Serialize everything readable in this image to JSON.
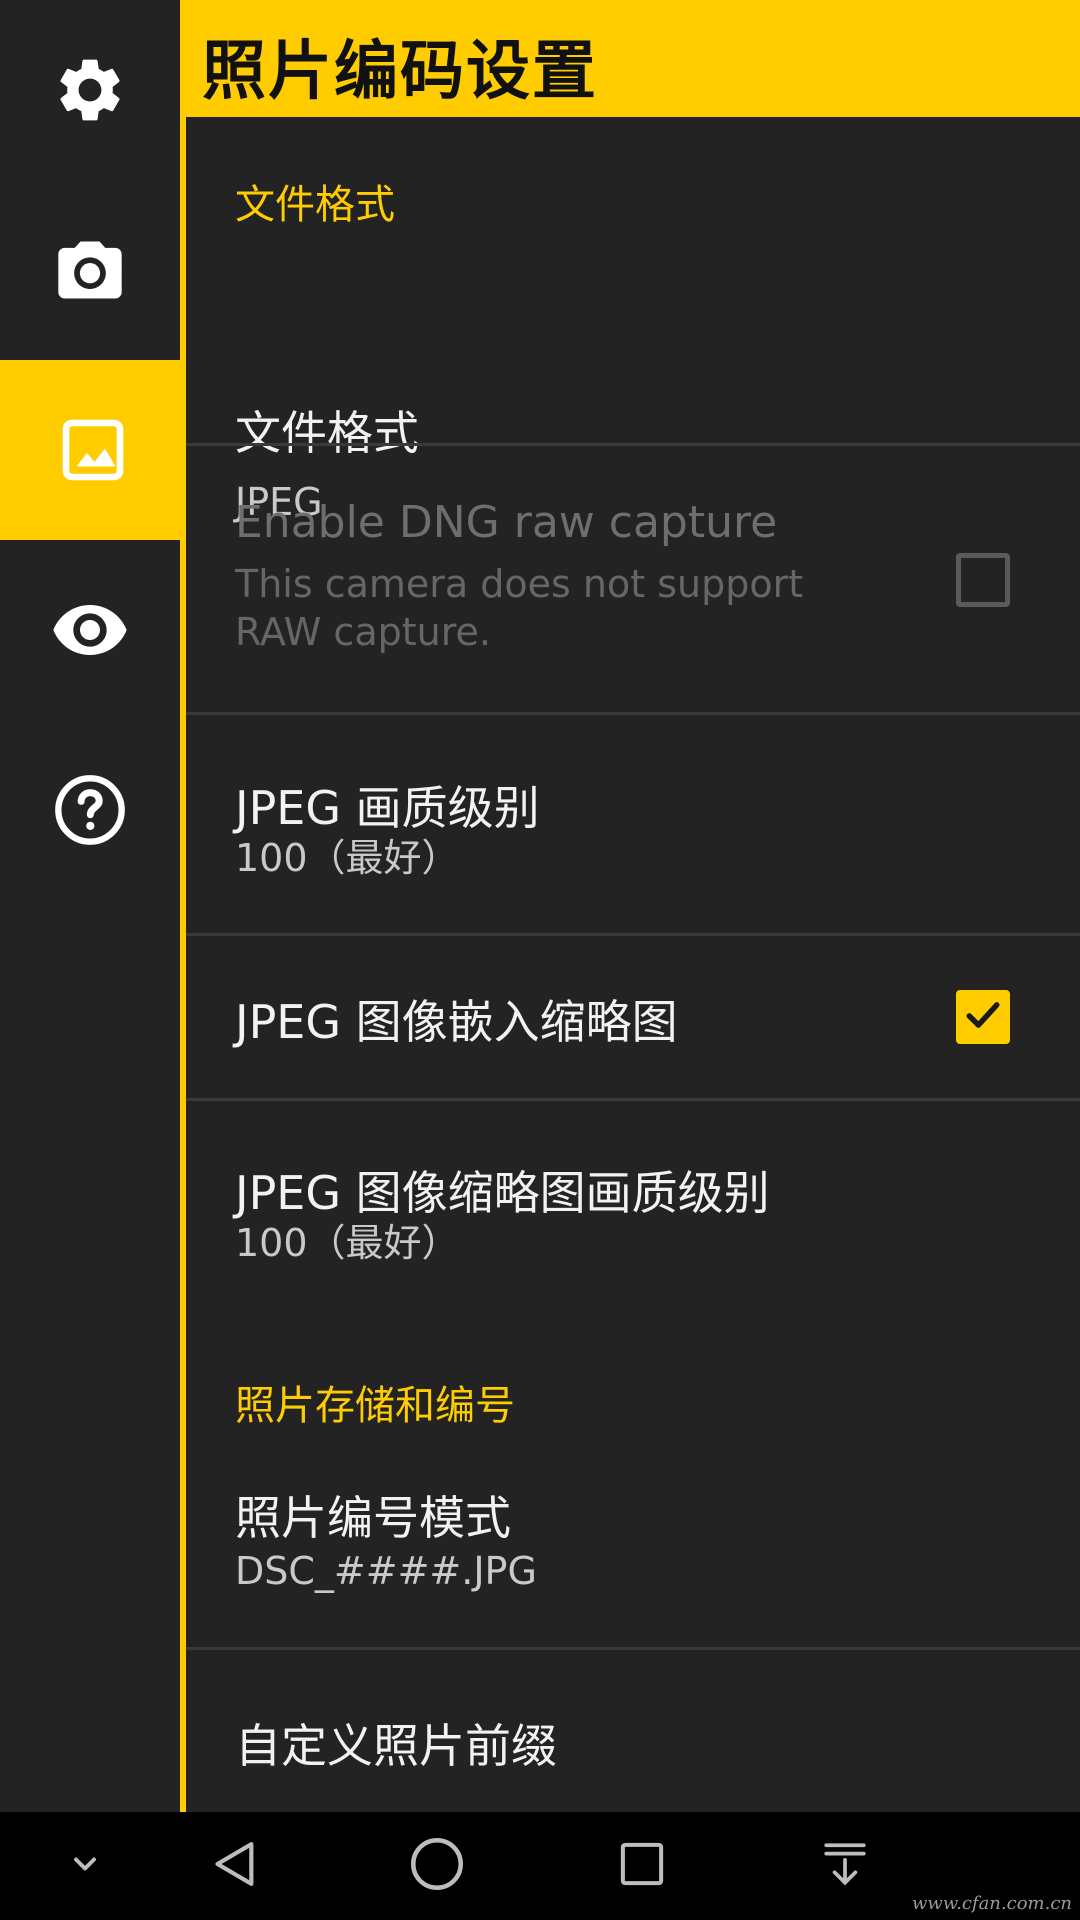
{
  "header": {
    "title": "照片编码设置"
  },
  "sidebar": {
    "items": [
      {
        "icon": "gear-icon",
        "active": false
      },
      {
        "icon": "camera-icon",
        "active": false
      },
      {
        "icon": "image-icon",
        "active": true
      },
      {
        "icon": "eye-icon",
        "active": false
      },
      {
        "icon": "help-icon",
        "active": false
      }
    ]
  },
  "sections": {
    "file_format": {
      "header": "文件格式"
    },
    "storage": {
      "header": "照片存储和编号"
    }
  },
  "prefs": {
    "file_format": {
      "title": "文件格式",
      "summary": "JPEG"
    },
    "dng": {
      "title": "Enable DNG raw capture",
      "summary_line1": "This camera does not support",
      "summary_line2": "RAW capture.",
      "checked": false,
      "enabled": false
    },
    "jpeg_quality": {
      "title": "JPEG 画质级别",
      "summary": "100（最好）"
    },
    "embed_thumb": {
      "title": "JPEG 图像嵌入缩略图",
      "checked": true
    },
    "thumb_quality": {
      "title": "JPEG 图像缩略图画质级别",
      "summary": "100（最好）"
    },
    "numbering_mode": {
      "title": "照片编号模式",
      "summary": "DSC_####.JPG"
    },
    "custom_prefix": {
      "title": "自定义照片前缀"
    }
  },
  "navbar": {
    "buttons": [
      "chevron-down-icon",
      "back-icon",
      "home-icon",
      "recents-icon",
      "notification-pulldown-icon"
    ]
  },
  "watermark": "www.cfan.com.cn",
  "colors": {
    "accent": "#FFCC00",
    "background": "#232323",
    "navbar": "#000000"
  }
}
